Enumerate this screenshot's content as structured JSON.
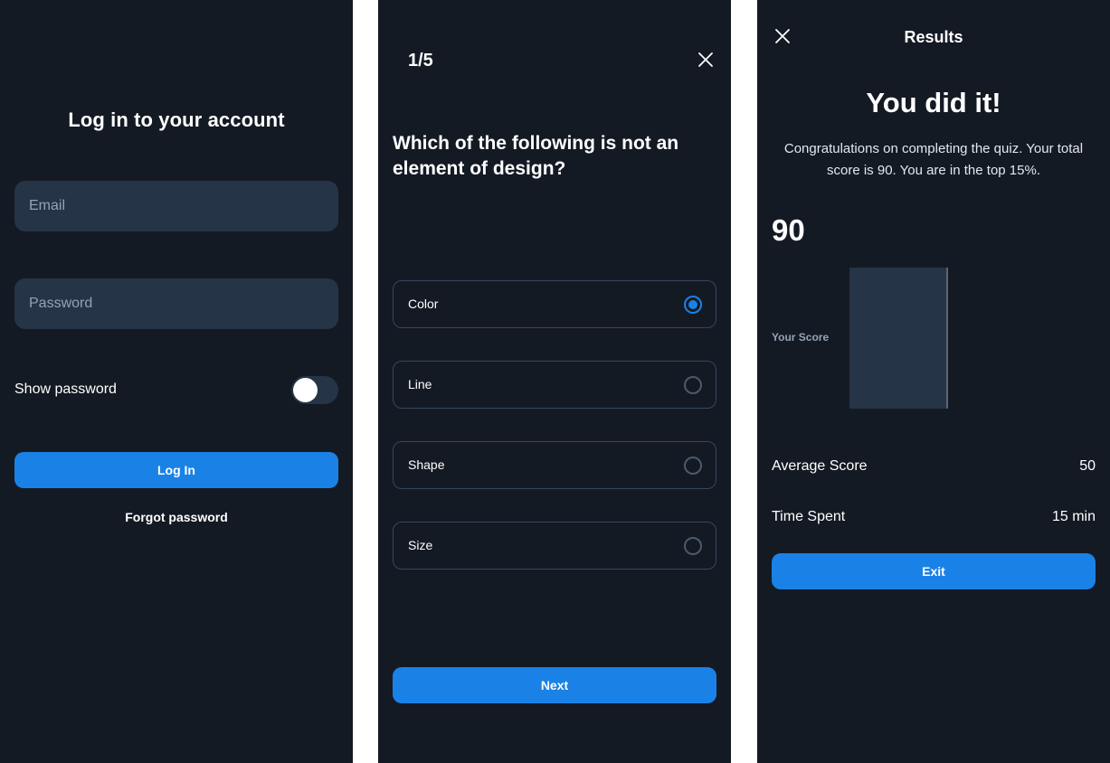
{
  "colors": {
    "background": "#141a23",
    "field": "#253447",
    "accent": "#1a82e6",
    "border": "#36475e",
    "muted": "#94a3b8"
  },
  "login": {
    "title": "Log in to your account",
    "email_placeholder": "Email",
    "password_placeholder": "Password",
    "show_password_label": "Show password",
    "show_password_on": false,
    "login_button": "Log In",
    "forgot_password": "Forgot password"
  },
  "quiz": {
    "progress": "1/5",
    "close_icon": "close-icon",
    "question": "Which of the following is not an element of design?",
    "options": [
      {
        "label": "Color",
        "selected": true
      },
      {
        "label": "Line",
        "selected": false
      },
      {
        "label": "Shape",
        "selected": false
      },
      {
        "label": "Size",
        "selected": false
      }
    ],
    "next_button": "Next"
  },
  "results": {
    "close_icon": "close-icon",
    "heading": "Results",
    "title": "You did it!",
    "message": "Congratulations on completing the quiz. Your total score is 90. You are in the top 15%.",
    "score": "90",
    "score_label": "Your Score",
    "average_label": "Average Score",
    "average_value": "50",
    "time_label": "Time Spent",
    "time_value": "15 min",
    "exit_button": "Exit"
  }
}
